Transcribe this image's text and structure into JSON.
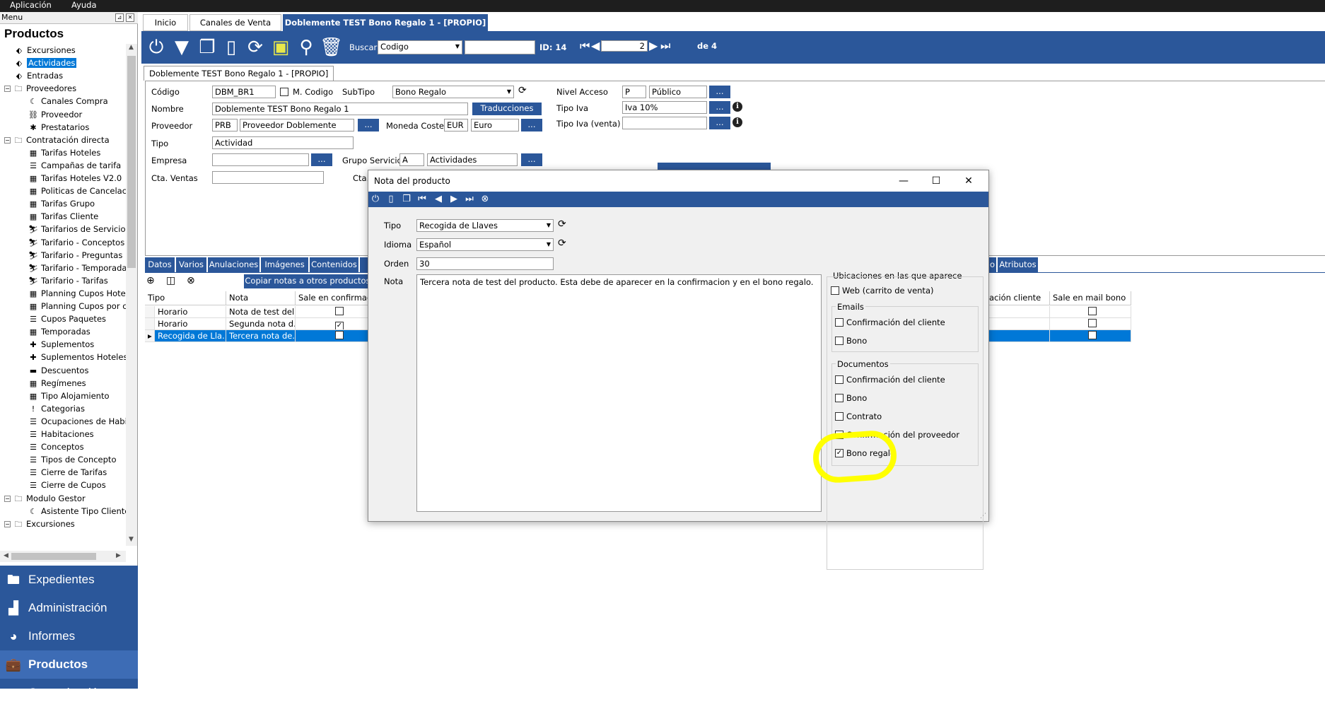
{
  "menubar": {
    "items": [
      "Aplicación",
      "Ayuda"
    ]
  },
  "left": {
    "menu_header": "Menu",
    "title": "Productos",
    "tree": [
      {
        "label": "Excursiones",
        "icon": "tag-icon",
        "glyph": "⬖",
        "level": 1
      },
      {
        "label": "Actividades",
        "icon": "tag-icon",
        "glyph": "⬖",
        "level": 1,
        "selected": true
      },
      {
        "label": "Entradas",
        "icon": "tag-icon",
        "glyph": "⬖",
        "level": 1
      },
      {
        "label": "Proveedores",
        "icon": "folder-icon",
        "glyph": "🗀",
        "level": 0,
        "expander": "−"
      },
      {
        "label": "Canales Compra",
        "icon": "channel-icon",
        "glyph": "☾",
        "level": 2
      },
      {
        "label": "Proveedor",
        "icon": "tree-icon",
        "glyph": "⛓",
        "level": 2
      },
      {
        "label": "Prestatarios",
        "icon": "puzzle-icon",
        "glyph": "✱",
        "level": 2
      },
      {
        "label": "Contratación directa",
        "icon": "folder-icon",
        "glyph": "🗀",
        "level": 0,
        "expander": "−"
      },
      {
        "label": "Tarifas Hoteles",
        "icon": "calendar-icon",
        "glyph": "▦",
        "level": 2
      },
      {
        "label": "Campañas de tarifa",
        "icon": "list-icon",
        "glyph": "☰",
        "level": 2
      },
      {
        "label": "Tarifas Hoteles V2.0",
        "icon": "calendar-icon",
        "glyph": "▦",
        "level": 2
      },
      {
        "label": "Politicas de Cancelaci",
        "icon": "calendar-icon",
        "glyph": "▦",
        "level": 2
      },
      {
        "label": "Tarifas Grupo",
        "icon": "calendar-icon",
        "glyph": "▦",
        "level": 2
      },
      {
        "label": "Tarifas Cliente",
        "icon": "calendar-icon",
        "glyph": "▦",
        "level": 2
      },
      {
        "label": "Tarifarios de Servicios",
        "icon": "person-icon",
        "glyph": "⛷",
        "level": 2
      },
      {
        "label": "Tarifario - Conceptos",
        "icon": "person-icon",
        "glyph": "⛷",
        "level": 2
      },
      {
        "label": "Tarifario - Preguntas",
        "icon": "person-icon",
        "glyph": "⛷",
        "level": 2
      },
      {
        "label": "Tarifario - Temporadas",
        "icon": "person-icon",
        "glyph": "⛷",
        "level": 2
      },
      {
        "label": "Tarifario - Tarifas",
        "icon": "person-icon",
        "glyph": "⛷",
        "level": 2
      },
      {
        "label": "Planning Cupos Hotel",
        "icon": "calendar-icon",
        "glyph": "▦",
        "level": 2
      },
      {
        "label": "Planning Cupos por cli",
        "icon": "calendar-icon",
        "glyph": "▦",
        "level": 2
      },
      {
        "label": "Cupos Paquetes",
        "icon": "list-icon",
        "glyph": "☰",
        "level": 2
      },
      {
        "label": "Temporadas",
        "icon": "calendar-icon",
        "glyph": "▦",
        "level": 2
      },
      {
        "label": "Suplementos",
        "icon": "plus-icon",
        "glyph": "✚",
        "level": 2
      },
      {
        "label": "Suplementos Hoteles",
        "icon": "plus-icon",
        "glyph": "✚",
        "level": 2
      },
      {
        "label": "Descuentos",
        "icon": "minus-icon",
        "glyph": "▬",
        "level": 2
      },
      {
        "label": "Regímenes",
        "icon": "calendar-icon",
        "glyph": "▦",
        "level": 2
      },
      {
        "label": "Tipo Alojamiento",
        "icon": "calendar-icon",
        "glyph": "▦",
        "level": 2
      },
      {
        "label": "Categorias",
        "icon": "exclamation-icon",
        "glyph": "!",
        "level": 2
      },
      {
        "label": "Ocupaciones de Habit",
        "icon": "list-icon",
        "glyph": "☰",
        "level": 2
      },
      {
        "label": "Habitaciones",
        "icon": "list-icon",
        "glyph": "☰",
        "level": 2
      },
      {
        "label": "Conceptos",
        "icon": "list-icon",
        "glyph": "☰",
        "level": 2
      },
      {
        "label": "Tipos de Concepto",
        "icon": "list-icon",
        "glyph": "☰",
        "level": 2
      },
      {
        "label": "Cierre de Tarifas",
        "icon": "list-icon",
        "glyph": "☰",
        "level": 2
      },
      {
        "label": "Cierre de Cupos",
        "icon": "list-icon",
        "glyph": "☰",
        "level": 2
      },
      {
        "label": "Modulo Gestor",
        "icon": "folder-icon",
        "glyph": "🗀",
        "level": 0,
        "expander": "−"
      },
      {
        "label": "Asistente Tipo Cliente",
        "icon": "channel-icon",
        "glyph": "☾",
        "level": 2
      },
      {
        "label": "Excursiones",
        "icon": "folder-icon",
        "glyph": "🗀",
        "level": 0,
        "expander": "−"
      }
    ],
    "nav": [
      {
        "label": "Expedientes",
        "icon": "folder-icon",
        "glyph": "🖿"
      },
      {
        "label": "Administración",
        "icon": "bar-chart-icon",
        "glyph": "▟"
      },
      {
        "label": "Informes",
        "icon": "pie-chart-icon",
        "glyph": "◕"
      },
      {
        "label": "Productos",
        "icon": "briefcase-icon",
        "glyph": "💼",
        "active": true
      },
      {
        "label": "Comunicación",
        "icon": "monitor-icon",
        "glyph": "▭"
      }
    ]
  },
  "tabs": [
    {
      "label": "Inicio"
    },
    {
      "label": "Canales de Venta"
    },
    {
      "label": "Doblemente TEST Bono Regalo 1 - [PROPIO]",
      "active": true
    }
  ],
  "toolbar": {
    "buscar_label": "Buscar",
    "search_field": "Codigo",
    "search_value": "",
    "id_label": "ID: 14",
    "page_value": "2",
    "of_label": "de 4"
  },
  "doc_tab": "Doblemente TEST Bono Regalo 1 - [PROPIO]",
  "form": {
    "codigo_label": "Código",
    "codigo": "DBM_BR1",
    "mcodigo_label": "M. Codigo",
    "subtipo_label": "SubTipo",
    "subtipo": "Bono Regalo",
    "nivel_label": "Nivel Acceso",
    "nivel_code": "P",
    "nivel_name": "Público",
    "nombre_label": "Nombre",
    "nombre": "Doblemente TEST Bono Regalo 1",
    "traducciones": "Traducciones",
    "tipoiva_label": "Tipo Iva",
    "tipoiva": "Iva 10%",
    "proveedor_label": "Proveedor",
    "proveedor_code": "PRB",
    "proveedor_name": "Proveedor Doblemente",
    "moneda_label": "Moneda Coste",
    "moneda_code": "EUR",
    "moneda_name": "Euro",
    "tipoiva_venta_label": "Tipo Iva (venta)",
    "tipoiva_venta": "",
    "tipo_label": "Tipo",
    "tipo": "Actividad",
    "empresa_label": "Empresa",
    "empresa": "",
    "gruposervicio_label": "Grupo Servicio",
    "grupo_code": "A",
    "grupo_name": "Actividades",
    "ctaventas_label": "Cta. Ventas",
    "ctaventas": "",
    "cta_partial": "Cta.",
    "dots": "..."
  },
  "lower_tabs": [
    "Datos",
    "Varios",
    "Anulaciones",
    "Imágenes",
    "Contenidos",
    "o",
    "Atributos"
  ],
  "grid": {
    "copy_button": "Copiar notas a otros productos",
    "headers": [
      "Tipo",
      "Nota",
      "Sale en confirmació",
      "ación cliente",
      "Sale en mail bono"
    ],
    "rows": [
      {
        "tipo": "Horario",
        "nota": "Nota de test del...",
        "confirm": false,
        "mail": false
      },
      {
        "tipo": "Horario",
        "nota": "Segunda nota d...",
        "confirm": true,
        "mail": false
      },
      {
        "tipo": "Recogida de Lla...",
        "nota": "Tercera nota de...",
        "confirm": false,
        "mail": false,
        "selected": true
      }
    ]
  },
  "modal": {
    "title": "Nota del producto",
    "tipo_label": "Tipo",
    "tipo": "Recogida de Llaves",
    "idioma_label": "Idioma",
    "idioma": "Español",
    "orden_label": "Orden",
    "orden": "30",
    "nota_label": "Nota",
    "nota": "Tercera nota de test del producto. Esta debe de aparecer en la confirmacion y en el bono regalo.",
    "ubicaciones_title": "Ubicaciones en las que aparece",
    "web": "Web (carrito de venta)",
    "emails_title": "Emails",
    "emails_confirm": "Confirmación del cliente",
    "emails_bono": "Bono",
    "docs_title": "Documentos",
    "docs_confirm": "Confirmación del cliente",
    "docs_bono": "Bono",
    "docs_contrato": "Contrato",
    "docs_proveedor": "Confirmación del proveedor",
    "docs_bonoregalo": "Bono regalo",
    "bonoregalo_checked": true
  },
  "colors": {
    "brand": "#2b579a",
    "selection": "#0078d7",
    "highlight": "#ffff00"
  }
}
